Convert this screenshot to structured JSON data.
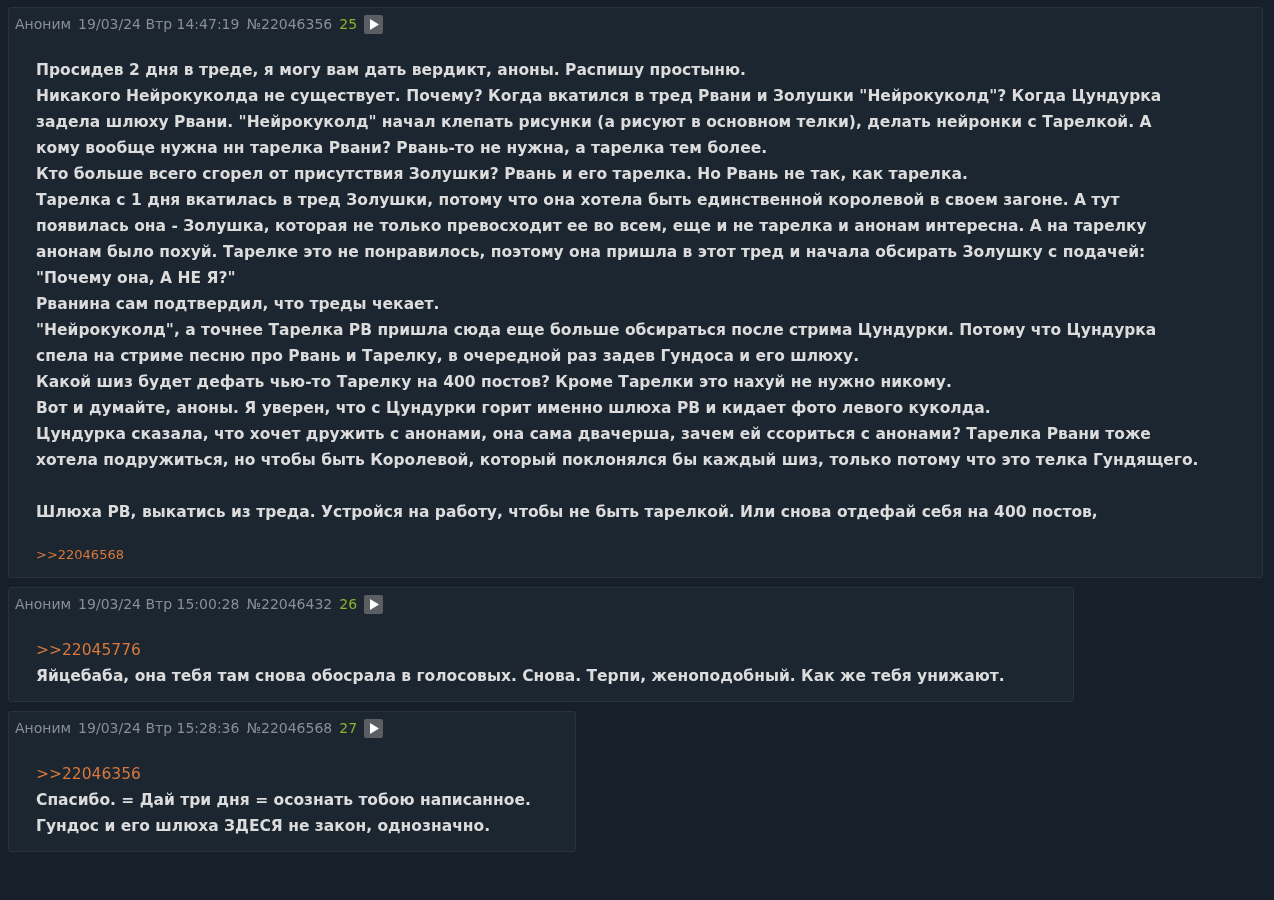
{
  "posts": [
    {
      "author": "Аноним",
      "date": "19/03/24 Втр 14:47:19",
      "number": "№22046356",
      "index": "25",
      "paragraphs": [
        [
          "Просидев 2 дня в треде, я могу вам дать вердикт, аноны. Распишу простыню.",
          "Никакого Нейрокуколда не существует. Почему? Когда вкатился в тред Рвани и Золушки \"Нейрокуколд\"? Когда Цундурка",
          "задела шлюху Рвани. \"Нейрокуколд\" начал клепать рисунки (а рисуют в основном телки), делать нейронки с Тарелкой. А",
          "кому вообще нужна нн тарелка Рвани? Рвань-то не нужна, а тарелка тем более.",
          "Кто больше всего сгорел от присутствия Золушки? Рвань и его тарелка. Но Рвань не так, как тарелка.",
          "Тарелка с 1 дня вкатилась в тред Золушки, потому что она хотела быть единственной королевой в своем загоне. А тут",
          "появилась она - Золушка, которая не только превосходит ее во всем, еще и не тарелка и анонам интересна. А на тарелку",
          "анонам было похуй. Тарелке это не понравилось, поэтому она пришла в этот тред и начала обсирать Золушку с подачей:",
          "\"Почему она, А НЕ Я?\"",
          "Рванина сам подтвердил, что треды чекает.",
          "\"Нейрокуколд\", а точнее Тарелка РВ пришла сюда еще больше обсираться после стрима Цундурки. Потому что Цундурка",
          "спела на стриме песню про Рвань и Тарелку, в очередной раз задев Гундоса и его шлюху.",
          "Какой шиз будет дефать чью-то Тарелку на 400 постов? Кроме Тарелки это нахуй не нужно никому.",
          "Вот и думайте, аноны. Я уверен, что с Цундурки горит именно шлюха РВ и кидает фото левого куколда.",
          "Цундурка сказала, что хочет дружить с анонами, она сама двачерша, зачем ей ссориться с анонами? Тарелка Рвани тоже",
          "хотела подружиться, но чтобы быть Королевой, который поклонялся бы каждый шиз, только потому что это телка Гундящего."
        ],
        [
          "Шлюха РВ, выкатись из треда. Устройся на работу, чтобы не быть тарелкой. Или снова отдефай себя на 400 постов,"
        ]
      ],
      "replies": [
        ">>22046568"
      ]
    },
    {
      "author": "Аноним",
      "date": "19/03/24 Втр 15:00:28",
      "number": "№22046432",
      "index": "26",
      "reply_to": ">>22045776",
      "paragraphs": [
        [
          "Яйцебаба, она тебя там снова обосрала в голосовых. Снова. Терпи, женоподобный. Как же тебя унижают."
        ]
      ]
    },
    {
      "author": "Аноним",
      "date": "19/03/24 Втр 15:28:36",
      "number": "№22046568",
      "index": "27",
      "reply_to": ">>22046356",
      "paragraphs": [
        [
          "Спасибо. = Дай три дня = осознать тобою написанное.",
          "Гундос и его шлюха ЗДЕСЯ не закон, однозначно."
        ]
      ]
    }
  ]
}
